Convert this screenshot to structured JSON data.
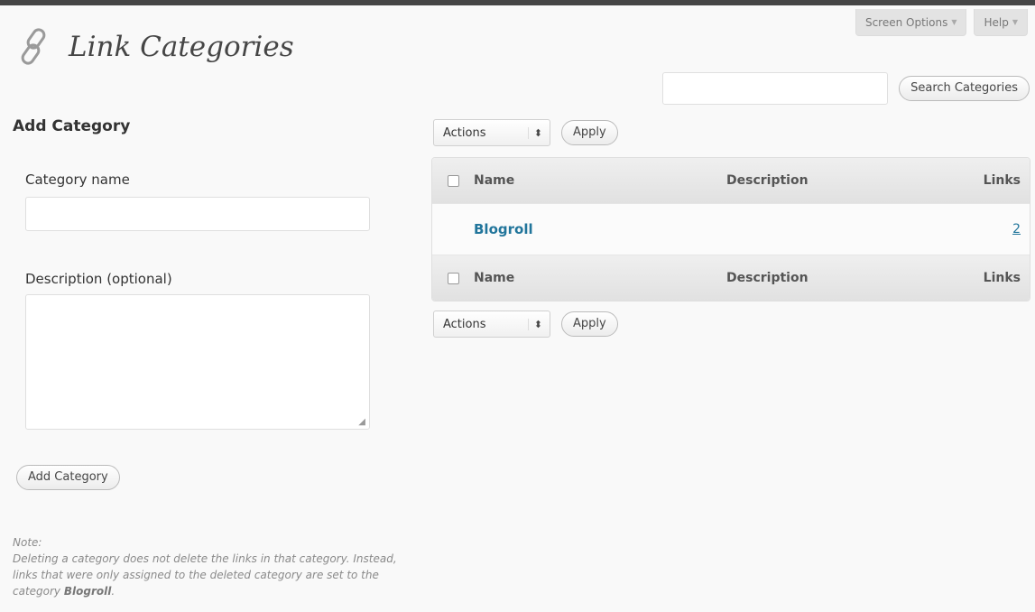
{
  "screen_options": {
    "screen_options_label": "Screen Options",
    "help_label": "Help"
  },
  "page": {
    "title": "Link Categories"
  },
  "search": {
    "value": "",
    "button_label": "Search Categories"
  },
  "add_form": {
    "heading": "Add Category",
    "name_label": "Category name",
    "name_value": "",
    "description_label": "Description (optional)",
    "description_value": "",
    "submit_label": "Add Category"
  },
  "note": {
    "label": "Note:",
    "text": "Deleting a category does not delete the links in that category. Instead, links that were only assigned to the deleted category are set to the category",
    "category": "Blogroll",
    "end": "."
  },
  "bulk_actions": {
    "select_value": "Actions",
    "apply_label": "Apply"
  },
  "table": {
    "columns": {
      "name": "Name",
      "description": "Description",
      "links": "Links"
    },
    "rows": [
      {
        "name": "Blogroll",
        "description": "",
        "links": "2"
      }
    ]
  },
  "colors": {
    "link": "#21759b",
    "admin_bar": "#464646",
    "background": "#f9f9f9"
  },
  "icons": {
    "page": "links-chain-icon",
    "select": "select-arrows-icon",
    "dropdown": "chevron-down-icon",
    "resize": "resize-handle-icon"
  }
}
